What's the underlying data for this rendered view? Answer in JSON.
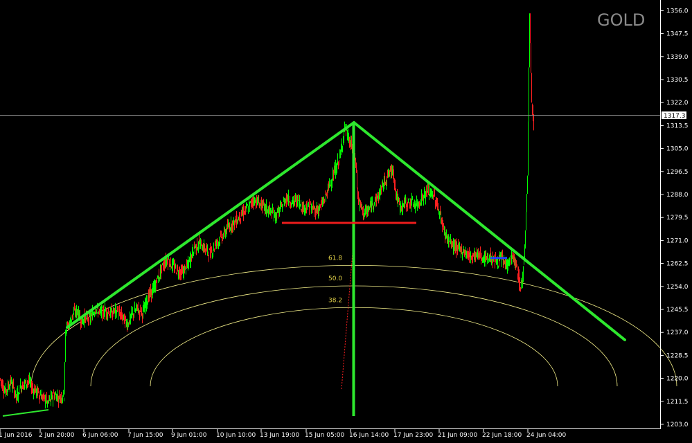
{
  "chart_data": {
    "type": "candlestick",
    "symbol": "GOLD",
    "current_price": "1317.3",
    "ylim": [
      1200.5,
      1360.5
    ],
    "y_ticks": [
      "1356.0",
      "1347.5",
      "1339.0",
      "1330.5",
      "1322.0",
      "1313.5",
      "1305.0",
      "1296.5",
      "1288.0",
      "1279.5",
      "1271.0",
      "1262.5",
      "1254.0",
      "1245.5",
      "1237.0",
      "1228.5",
      "1220.0",
      "1211.5",
      "1203.0"
    ],
    "x_labels": [
      "1 Jun 2016",
      "2 Jun 20:00",
      "6 Jun 06:00",
      "7 Jun 15:00",
      "9 Jun 01:00",
      "10 Jun 10:00",
      "13 Jun 19:00",
      "15 Jun 05:00",
      "16 Jun 14:00",
      "17 Jun 23:00",
      "21 Jun 09:00",
      "22 Jun 18:00",
      "24 Jun 04:00"
    ],
    "price_path": [
      [
        0,
        1220
      ],
      [
        8,
        1215
      ],
      [
        16,
        1219
      ],
      [
        24,
        1213
      ],
      [
        30,
        1217
      ],
      [
        36,
        1218
      ],
      [
        42,
        1219
      ],
      [
        48,
        1216
      ],
      [
        54,
        1215
      ],
      [
        62,
        1213
      ],
      [
        70,
        1211
      ],
      [
        78,
        1214
      ],
      [
        86,
        1213
      ],
      [
        93,
        1214
      ],
      [
        95,
        1238
      ],
      [
        100,
        1240
      ],
      [
        106,
        1244
      ],
      [
        112,
        1245
      ],
      [
        118,
        1241
      ],
      [
        124,
        1243
      ],
      [
        130,
        1242
      ],
      [
        138,
        1246
      ],
      [
        146,
        1244
      ],
      [
        152,
        1245
      ],
      [
        160,
        1244
      ],
      [
        168,
        1245
      ],
      [
        176,
        1243
      ],
      [
        184,
        1240
      ],
      [
        190,
        1243
      ],
      [
        198,
        1246
      ],
      [
        206,
        1244
      ],
      [
        214,
        1250
      ],
      [
        222,
        1253
      ],
      [
        230,
        1258
      ],
      [
        236,
        1262
      ],
      [
        242,
        1264
      ],
      [
        248,
        1262
      ],
      [
        256,
        1260
      ],
      [
        264,
        1259
      ],
      [
        272,
        1262
      ],
      [
        280,
        1268
      ],
      [
        288,
        1270
      ],
      [
        296,
        1268
      ],
      [
        304,
        1266
      ],
      [
        312,
        1270
      ],
      [
        320,
        1272
      ],
      [
        330,
        1276
      ],
      [
        340,
        1278
      ],
      [
        350,
        1281
      ],
      [
        358,
        1283
      ],
      [
        366,
        1286
      ],
      [
        374,
        1285
      ],
      [
        382,
        1283
      ],
      [
        390,
        1282
      ],
      [
        398,
        1280
      ],
      [
        406,
        1283
      ],
      [
        414,
        1287
      ],
      [
        422,
        1285
      ],
      [
        430,
        1286
      ],
      [
        438,
        1283
      ],
      [
        446,
        1284
      ],
      [
        454,
        1282
      ],
      [
        462,
        1283
      ],
      [
        470,
        1287
      ],
      [
        478,
        1293
      ],
      [
        486,
        1298
      ],
      [
        492,
        1303
      ],
      [
        498,
        1313
      ],
      [
        503,
        1309
      ],
      [
        506,
        1307
      ],
      [
        510,
        1304
      ],
      [
        514,
        1300
      ],
      [
        517,
        1287
      ],
      [
        520,
        1284
      ],
      [
        526,
        1281
      ],
      [
        532,
        1282
      ],
      [
        538,
        1285
      ],
      [
        546,
        1287
      ],
      [
        554,
        1292
      ],
      [
        562,
        1296
      ],
      [
        568,
        1297
      ],
      [
        572,
        1288
      ],
      [
        578,
        1283
      ],
      [
        586,
        1285
      ],
      [
        594,
        1285
      ],
      [
        602,
        1284
      ],
      [
        610,
        1287
      ],
      [
        618,
        1289
      ],
      [
        626,
        1288
      ],
      [
        634,
        1282
      ],
      [
        642,
        1274
      ],
      [
        650,
        1270
      ],
      [
        660,
        1268
      ],
      [
        670,
        1267
      ],
      [
        680,
        1265
      ],
      [
        690,
        1266
      ],
      [
        700,
        1264
      ],
      [
        708,
        1265
      ],
      [
        716,
        1263
      ],
      [
        724,
        1264
      ],
      [
        732,
        1262
      ],
      [
        740,
        1265
      ],
      [
        746,
        1261
      ],
      [
        752,
        1253
      ],
      [
        755,
        1258
      ],
      [
        758,
        1268
      ],
      [
        762,
        1295
      ],
      [
        765,
        1355
      ],
      [
        768,
        1322
      ],
      [
        771,
        1315
      ]
    ],
    "annotations": {
      "green_lines": [
        {
          "from": [
            "2 Jun 20:00",
            1240
          ],
          "to": [
            "16 Jun 00:00",
            1315
          ]
        },
        {
          "from": [
            "16 Jun 00:00",
            1315
          ],
          "to": [
            "25 Jun 02:00",
            1235
          ]
        },
        {
          "from": [
            "16 Jun 00:00",
            1315
          ],
          "to": [
            "16 Jun 00:00",
            1206
          ]
        },
        {
          "from": [
            "1 Jun 00:00",
            1207
          ],
          "to": [
            "2 Jun 10:00",
            1209
          ]
        }
      ],
      "red_support_line": {
        "price": 1278,
        "from": "13 Jun 19:00",
        "to": "18 Jun 00:00"
      },
      "fibonacci_arcs": [
        {
          "label": "61.8",
          "top_price": 1261.8
        },
        {
          "label": "50.0",
          "top_price": 1254.2
        },
        {
          "label": "38.2",
          "top_price": 1246.2
        }
      ]
    },
    "grid": false,
    "colors": {
      "background": "#000000",
      "up_bar": "#00ff00",
      "down_bar": "#ff2020",
      "trend_lines": "#2ee82e",
      "support_line": "#ee1c1c",
      "fib_arcs": "#f5f08a",
      "fib_labels": "#e6d54a",
      "axis": "#ffffff",
      "current_price_line": "#8c8c8c"
    }
  }
}
